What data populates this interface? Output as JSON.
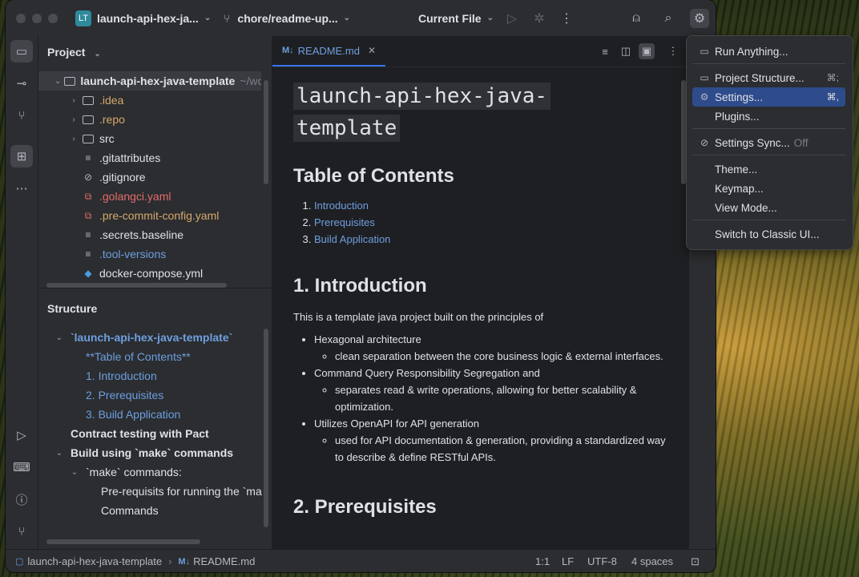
{
  "titlebar": {
    "project_badge": "LT",
    "project_name": "launch-api-hex-ja...",
    "branch": "chore/readme-up...",
    "run_config": "Current File"
  },
  "project_panel": {
    "title": "Project",
    "tree": [
      {
        "label": "launch-api-hex-java-template",
        "hint": "~/wo",
        "arrow": "⌄",
        "icon": "folder-icon",
        "style": "root"
      },
      {
        "label": ".idea",
        "arrow": "›",
        "icon": "folder-icon",
        "style": "orange"
      },
      {
        "label": ".repo",
        "arrow": "›",
        "icon": "folder-icon",
        "style": "orange"
      },
      {
        "label": "src",
        "arrow": "›",
        "icon": "folder-icon",
        "style": "normal"
      },
      {
        "label": ".gitattributes",
        "arrow": "",
        "icon": "text-file-icon",
        "style": "normal"
      },
      {
        "label": ".gitignore",
        "arrow": "",
        "icon": "ignore-file-icon",
        "style": "normal"
      },
      {
        "label": ".golangci.yaml",
        "arrow": "",
        "icon": "yaml-file-icon",
        "style": "red"
      },
      {
        "label": ".pre-commit-config.yaml",
        "arrow": "",
        "icon": "yaml-file-icon",
        "style": "orange"
      },
      {
        "label": ".secrets.baseline",
        "arrow": "",
        "icon": "text-file-icon",
        "style": "normal"
      },
      {
        "label": ".tool-versions",
        "arrow": "",
        "icon": "text-file-icon",
        "style": "blue"
      },
      {
        "label": "docker-compose.yml",
        "arrow": "",
        "icon": "docker-icon",
        "style": "normal"
      }
    ]
  },
  "structure": {
    "title": "Structure",
    "items": [
      {
        "label": "`launch-api-hex-java-template`",
        "arrow": "⌄",
        "style": "blue-bold",
        "indent": 0
      },
      {
        "label": "**Table of Contents**",
        "arrow": "",
        "style": "blue",
        "indent": 1
      },
      {
        "label": "1. Introduction",
        "arrow": "",
        "style": "blue",
        "indent": 1
      },
      {
        "label": "2. Prerequisites",
        "arrow": "",
        "style": "blue",
        "indent": 1
      },
      {
        "label": "3. Build Application",
        "arrow": "",
        "style": "blue",
        "indent": 1
      },
      {
        "label": "Contract testing with Pact",
        "arrow": "",
        "style": "bold",
        "indent": 0
      },
      {
        "label": "Build using `make` commands",
        "arrow": "⌄",
        "style": "bold",
        "indent": 0
      },
      {
        "label": "`make` commands:",
        "arrow": "⌄",
        "style": "normal",
        "indent": 1
      },
      {
        "label": "Pre-requisits for running the `ma",
        "arrow": "",
        "style": "normal",
        "indent": 2
      },
      {
        "label": "Commands",
        "arrow": "",
        "style": "normal",
        "indent": 2
      }
    ]
  },
  "editor": {
    "tab_icon": "M↓",
    "tab_label": "README.md",
    "h1_line1": "launch-api-hex-java-",
    "h1_line2": "template",
    "toc_heading": "Table of Contents",
    "toc": [
      "Introduction",
      "Prerequisites",
      "Build Application"
    ],
    "intro_heading": "1. Introduction",
    "intro_text": "This is a template java project built on the principles of",
    "bullets": [
      {
        "text": "Hexagonal architecture",
        "sub": "clean separation between the core business logic & external interfaces."
      },
      {
        "text": "Command Query Responsibility Segregation and",
        "sub": "separates read & write operations, allowing for better scalability & optimization."
      },
      {
        "text": "Utilizes OpenAPI for API generation",
        "sub": "used for API documentation & generation, providing a standardized way to describe & define RESTful APIs."
      }
    ],
    "next_heading": "2. Prerequisites"
  },
  "statusbar": {
    "crumb_project": "launch-api-hex-java-template",
    "crumb_file": "README.md",
    "position": "1:1",
    "line_sep": "LF",
    "encoding": "UTF-8",
    "indent": "4 spaces"
  },
  "menu": {
    "items": [
      {
        "label": "Run Anything...",
        "icon": "run-anything-icon",
        "glyph": "▭",
        "shortcut": ""
      },
      {
        "label": "Project Structure...",
        "icon": "project-structure-icon",
        "glyph": "▭",
        "shortcut": "⌘;"
      },
      {
        "label": "Settings...",
        "icon": "gear-icon",
        "glyph": "⚙",
        "shortcut": "⌘,"
      },
      {
        "label": "Plugins...",
        "icon": "",
        "glyph": "",
        "shortcut": ""
      },
      {
        "label": "Settings Sync...",
        "icon": "sync-disabled-icon",
        "glyph": "⊘",
        "shortcut": ""
      },
      {
        "label": "Theme...",
        "icon": "",
        "glyph": "",
        "shortcut": ""
      },
      {
        "label": "Keymap...",
        "icon": "",
        "glyph": "",
        "shortcut": ""
      },
      {
        "label": "View Mode...",
        "icon": "",
        "glyph": "",
        "shortcut": ""
      },
      {
        "label": "Switch to Classic UI...",
        "icon": "",
        "glyph": "",
        "shortcut": ""
      }
    ],
    "sync_state": "Off",
    "selected": "Settings..."
  }
}
